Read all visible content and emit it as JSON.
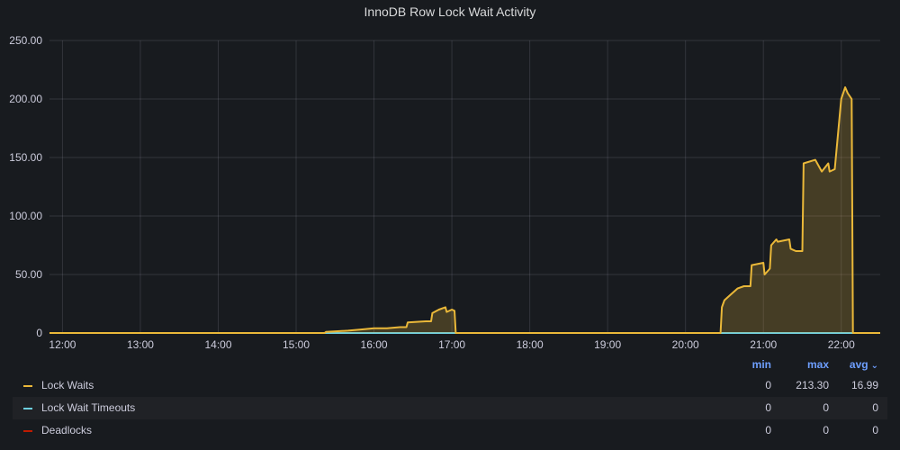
{
  "panel": {
    "title": "InnoDB Row Lock Wait Activity"
  },
  "legend": {
    "headers": {
      "min": "min",
      "max": "max",
      "avg": "avg"
    },
    "rows": [
      {
        "name": "Lock Waits",
        "color": "#eab839",
        "min": "0",
        "max": "213.30",
        "avg": "16.99"
      },
      {
        "name": "Lock Wait Timeouts",
        "color": "#6ed0e0",
        "min": "0",
        "max": "0",
        "avg": "0"
      },
      {
        "name": "Deadlocks",
        "color": "#bf1b00",
        "min": "0",
        "max": "0",
        "avg": "0"
      }
    ]
  },
  "chart_data": {
    "type": "area",
    "title": "InnoDB Row Lock Wait Activity",
    "x_ticks": [
      "12:00",
      "13:00",
      "14:00",
      "15:00",
      "16:00",
      "17:00",
      "18:00",
      "19:00",
      "20:00",
      "21:00",
      "22:00"
    ],
    "y_ticks": [
      "0",
      "50.00",
      "100.00",
      "150.00",
      "200.00",
      "250.00"
    ],
    "ylim": [
      0,
      250
    ],
    "xlim": [
      "11:50",
      "22:30"
    ],
    "grid": true,
    "legend_position": "bottom",
    "series": [
      {
        "name": "Lock Waits",
        "color": "#eab839",
        "x": [
          "11:50",
          "15:22",
          "15:23",
          "15:40",
          "15:50",
          "16:00",
          "16:10",
          "16:20",
          "16:25",
          "16:26",
          "16:40",
          "16:44",
          "16:45",
          "16:50",
          "16:55",
          "16:56",
          "17:00",
          "17:02",
          "17:03",
          "20:27",
          "20:28",
          "20:30",
          "20:35",
          "20:40",
          "20:45",
          "20:50",
          "20:51",
          "21:00",
          "21:01",
          "21:05",
          "21:06",
          "21:10",
          "21:11",
          "21:20",
          "21:21",
          "21:25",
          "21:30",
          "21:31",
          "21:40",
          "21:45",
          "21:50",
          "21:51",
          "21:55",
          "22:00",
          "22:03",
          "22:05",
          "22:08",
          "22:09",
          "22:10",
          "22:30"
        ],
        "y": [
          0,
          0,
          1,
          2,
          3,
          4,
          4,
          5,
          5,
          9,
          10,
          10,
          17,
          20,
          22,
          18,
          20,
          19,
          0,
          0,
          22,
          28,
          33,
          38,
          40,
          40,
          58,
          60,
          50,
          55,
          75,
          80,
          78,
          80,
          72,
          70,
          70,
          145,
          148,
          138,
          145,
          138,
          140,
          200,
          210,
          205,
          200,
          0,
          0,
          0
        ]
      },
      {
        "name": "Lock Wait Timeouts",
        "color": "#6ed0e0",
        "x": [
          "11:50",
          "22:30"
        ],
        "y": [
          0,
          0
        ]
      },
      {
        "name": "Deadlocks",
        "color": "#bf1b00",
        "x": [
          "11:50",
          "22:30"
        ],
        "y": [
          0,
          0
        ]
      }
    ]
  }
}
